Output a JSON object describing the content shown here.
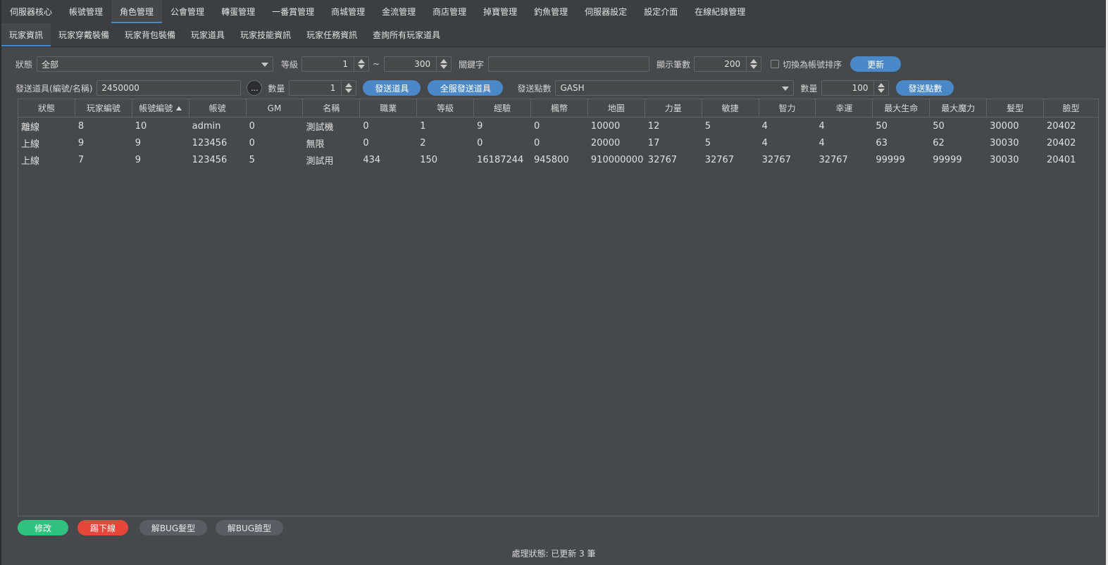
{
  "main_tabs": [
    "伺服器核心",
    "帳號管理",
    "角色管理",
    "公會管理",
    "轉蛋管理",
    "一番賞管理",
    "商城管理",
    "金流管理",
    "商店管理",
    "掉寶管理",
    "釣魚管理",
    "伺服器設定",
    "設定介面",
    "在線紀錄管理"
  ],
  "active_main_tab": 2,
  "sub_tabs": [
    "玩家資訊",
    "玩家穿戴裝備",
    "玩家背包裝備",
    "玩家道具",
    "玩家技能資訊",
    "玩家任務資訊",
    "查詢所有玩家道具"
  ],
  "active_sub_tab": 0,
  "filter": {
    "status_label": "狀態",
    "status_value": "全部",
    "level_label": "等級",
    "level_min": "1",
    "tilde": "~",
    "level_max": "300",
    "keyword_label": "關鍵字",
    "keyword_value": "",
    "display_count_label": "顯示筆數",
    "display_count": "200",
    "sort_by_account_label": "切換為帳號排序",
    "refresh_label": "更新"
  },
  "send": {
    "item_label": "發送道具(編號/名稱)",
    "item_value": "2450000",
    "browse_label": "...",
    "qty_label": "數量",
    "qty_value": "1",
    "send_item_label": "發送道具",
    "send_all_label": "全服發送道具",
    "points_label": "發送點數",
    "points_type": "GASH",
    "points_qty_label": "數量",
    "points_qty_value": "100",
    "send_points_label": "發送點數"
  },
  "table": {
    "columns": [
      "狀態",
      "玩家編號",
      "帳號編號",
      "帳號",
      "GM",
      "名稱",
      "職業",
      "等級",
      "經驗",
      "楓幣",
      "地圖",
      "力量",
      "敏捷",
      "智力",
      "幸運",
      "最大生命",
      "最大魔力",
      "髮型",
      "臉型"
    ],
    "sorted_column": 2,
    "rows": [
      [
        "離線",
        "8",
        "10",
        "admin",
        "0",
        "測試機",
        "0",
        "1",
        "9",
        "0",
        "10000",
        "12",
        "5",
        "4",
        "4",
        "50",
        "50",
        "30000",
        "20402"
      ],
      [
        "上線",
        "9",
        "9",
        "123456",
        "0",
        "無限",
        "0",
        "2",
        "0",
        "0",
        "20000",
        "17",
        "5",
        "4",
        "4",
        "63",
        "62",
        "30030",
        "20402"
      ],
      [
        "上線",
        "7",
        "9",
        "123456",
        "5",
        "測試用",
        "434",
        "150",
        "16187244",
        "945800",
        "910000000",
        "32767",
        "32767",
        "32767",
        "32767",
        "99999",
        "99999",
        "30030",
        "20401"
      ]
    ]
  },
  "actions": {
    "edit_label": "修改",
    "kick_label": "踢下線",
    "fix_hair_label": "解BUG髮型",
    "fix_face_label": "解BUG臉型"
  },
  "status_text": "處理狀態: 已更新 3 筆",
  "colors": {
    "accent": "#4a88c7",
    "edit": "#2ec27e",
    "kick": "#e5483a",
    "neutral": "#595e64"
  }
}
